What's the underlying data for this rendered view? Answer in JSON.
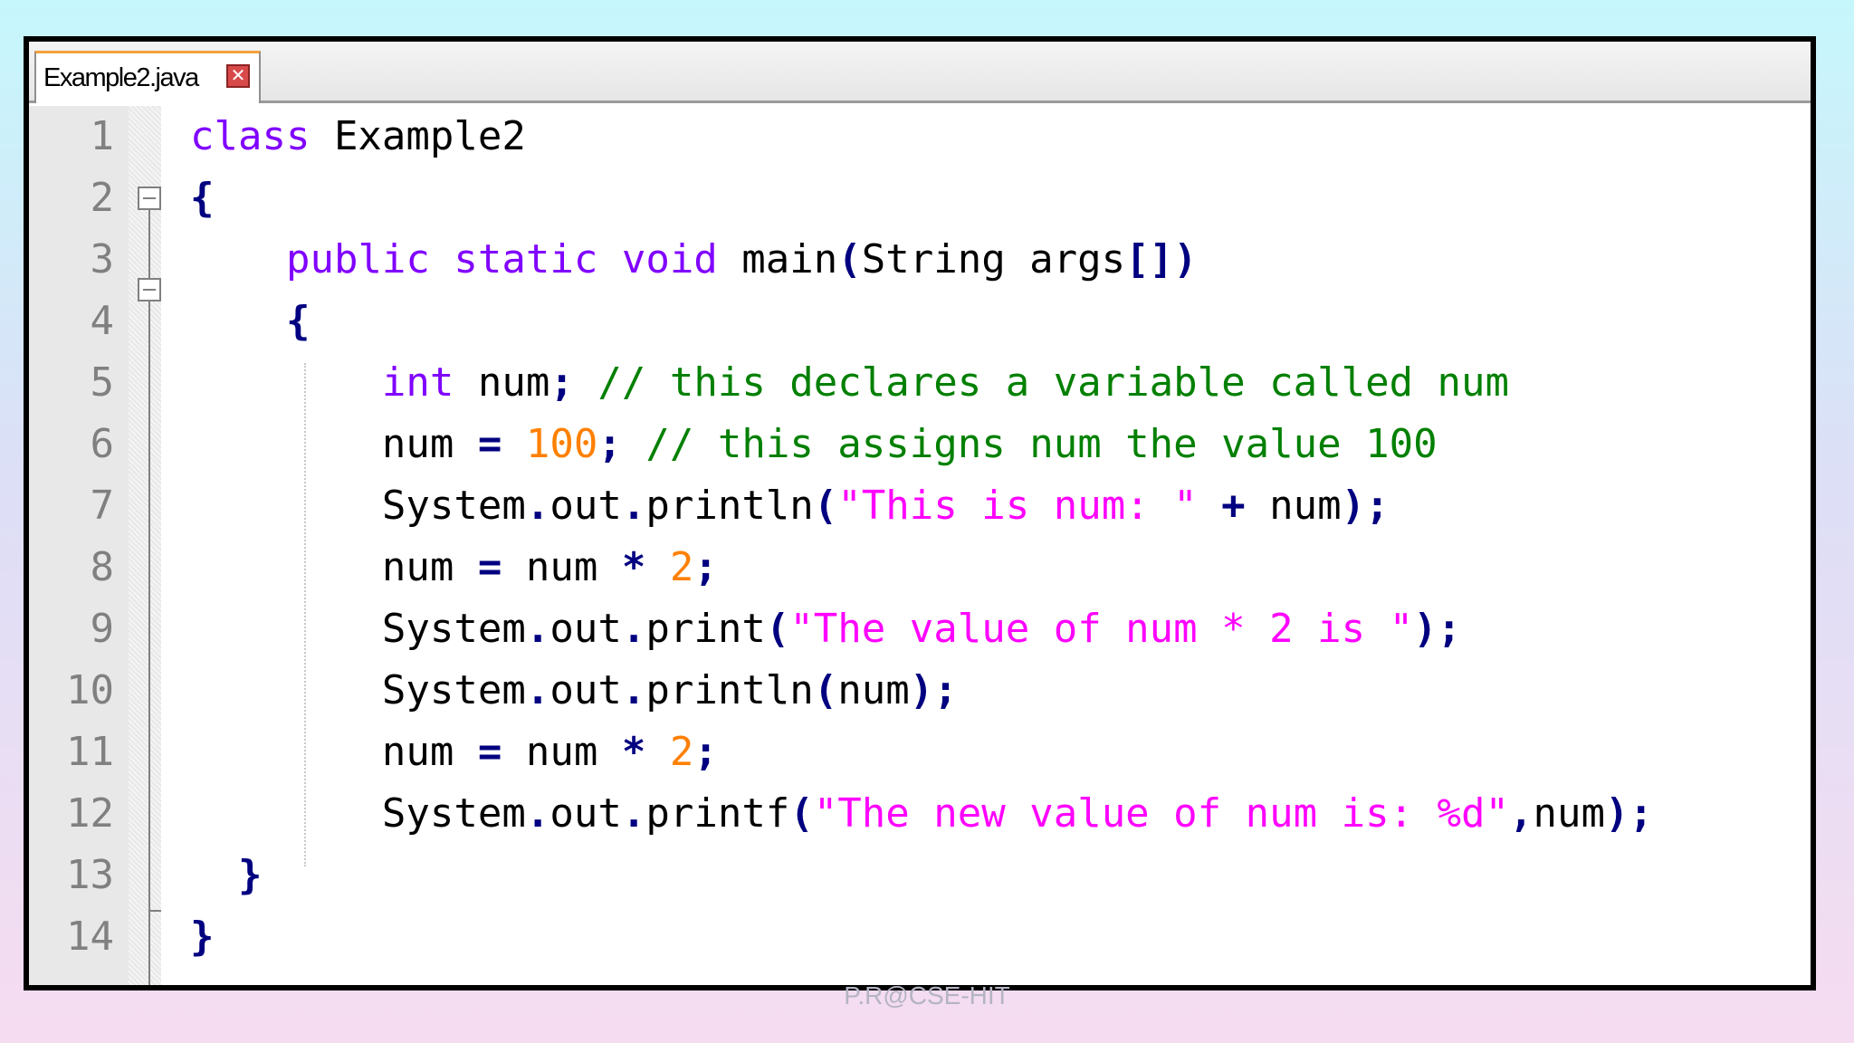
{
  "tab": {
    "title": "Example2.java",
    "close_glyph": "✕"
  },
  "footer_text": "P.R@CSE-HIT",
  "colors": {
    "keyword": "#8000ff",
    "comment": "#008000",
    "number": "#ff8000",
    "string": "#ff00ff",
    "operator": "#000080",
    "line_number": "#808080"
  },
  "lines": [
    {
      "number": "1",
      "tokens": [
        {
          "t": "kw",
          "v": "class"
        },
        {
          "t": "pl",
          "v": " Example2"
        }
      ]
    },
    {
      "number": "2",
      "tokens": [
        {
          "t": "op",
          "v": "{"
        }
      ]
    },
    {
      "number": "3",
      "tokens": [
        {
          "t": "pl",
          "v": "    "
        },
        {
          "t": "kw",
          "v": "public static void"
        },
        {
          "t": "pl",
          "v": " main"
        },
        {
          "t": "op",
          "v": "("
        },
        {
          "t": "pl",
          "v": "String args"
        },
        {
          "t": "op",
          "v": "[])"
        }
      ]
    },
    {
      "number": "4",
      "tokens": [
        {
          "t": "pl",
          "v": "    "
        },
        {
          "t": "op",
          "v": "{"
        }
      ]
    },
    {
      "number": "5",
      "tokens": [
        {
          "t": "pl",
          "v": "        "
        },
        {
          "t": "kw",
          "v": "int"
        },
        {
          "t": "pl",
          "v": " num"
        },
        {
          "t": "op",
          "v": ";"
        },
        {
          "t": "pl",
          "v": " "
        },
        {
          "t": "cm",
          "v": "// this declares a variable called num"
        }
      ]
    },
    {
      "number": "6",
      "tokens": [
        {
          "t": "pl",
          "v": "        num "
        },
        {
          "t": "op",
          "v": "="
        },
        {
          "t": "pl",
          "v": " "
        },
        {
          "t": "nm",
          "v": "100"
        },
        {
          "t": "op",
          "v": ";"
        },
        {
          "t": "pl",
          "v": " "
        },
        {
          "t": "cm",
          "v": "// this assigns num the value 100"
        }
      ]
    },
    {
      "number": "7",
      "tokens": [
        {
          "t": "pl",
          "v": "        System"
        },
        {
          "t": "op",
          "v": "."
        },
        {
          "t": "pl",
          "v": "out"
        },
        {
          "t": "op",
          "v": "."
        },
        {
          "t": "pl",
          "v": "println"
        },
        {
          "t": "op",
          "v": "("
        },
        {
          "t": "st",
          "v": "\"This is num: \""
        },
        {
          "t": "pl",
          "v": " "
        },
        {
          "t": "op",
          "v": "+"
        },
        {
          "t": "pl",
          "v": " num"
        },
        {
          "t": "op",
          "v": ");"
        }
      ]
    },
    {
      "number": "8",
      "tokens": [
        {
          "t": "pl",
          "v": "        num "
        },
        {
          "t": "op",
          "v": "="
        },
        {
          "t": "pl",
          "v": " num "
        },
        {
          "t": "op",
          "v": "*"
        },
        {
          "t": "pl",
          "v": " "
        },
        {
          "t": "nm",
          "v": "2"
        },
        {
          "t": "op",
          "v": ";"
        }
      ]
    },
    {
      "number": "9",
      "tokens": [
        {
          "t": "pl",
          "v": "        System"
        },
        {
          "t": "op",
          "v": "."
        },
        {
          "t": "pl",
          "v": "out"
        },
        {
          "t": "op",
          "v": "."
        },
        {
          "t": "pl",
          "v": "print"
        },
        {
          "t": "op",
          "v": "("
        },
        {
          "t": "st",
          "v": "\"The value of num * 2 is \""
        },
        {
          "t": "op",
          "v": ");"
        }
      ]
    },
    {
      "number": "10",
      "tokens": [
        {
          "t": "pl",
          "v": "        System"
        },
        {
          "t": "op",
          "v": "."
        },
        {
          "t": "pl",
          "v": "out"
        },
        {
          "t": "op",
          "v": "."
        },
        {
          "t": "pl",
          "v": "println"
        },
        {
          "t": "op",
          "v": "("
        },
        {
          "t": "pl",
          "v": "num"
        },
        {
          "t": "op",
          "v": ");"
        }
      ]
    },
    {
      "number": "11",
      "tokens": [
        {
          "t": "pl",
          "v": "        num "
        },
        {
          "t": "op",
          "v": "="
        },
        {
          "t": "pl",
          "v": " num "
        },
        {
          "t": "op",
          "v": "*"
        },
        {
          "t": "pl",
          "v": " "
        },
        {
          "t": "nm",
          "v": "2"
        },
        {
          "t": "op",
          "v": ";"
        }
      ]
    },
    {
      "number": "12",
      "tokens": [
        {
          "t": "pl",
          "v": "        System"
        },
        {
          "t": "op",
          "v": "."
        },
        {
          "t": "pl",
          "v": "out"
        },
        {
          "t": "op",
          "v": "."
        },
        {
          "t": "pl",
          "v": "printf"
        },
        {
          "t": "op",
          "v": "("
        },
        {
          "t": "st",
          "v": "\"The new value of num is: %d\""
        },
        {
          "t": "op",
          "v": ","
        },
        {
          "t": "pl",
          "v": "num"
        },
        {
          "t": "op",
          "v": ");"
        }
      ]
    },
    {
      "number": "13",
      "tokens": [
        {
          "t": "pl",
          "v": "  "
        },
        {
          "t": "op",
          "v": "}"
        }
      ]
    },
    {
      "number": "14",
      "tokens": [
        {
          "t": "op",
          "v": "}"
        }
      ]
    }
  ]
}
